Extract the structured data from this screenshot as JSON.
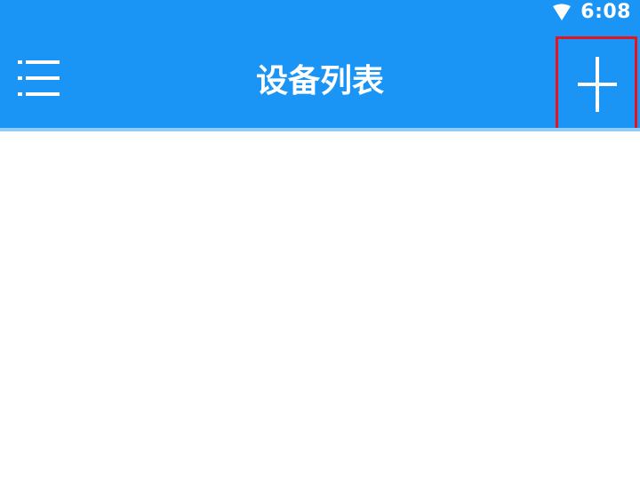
{
  "status_bar": {
    "time": "6:08",
    "signal_icon": "wifi-signal-icon"
  },
  "header": {
    "title": "设备列表",
    "menu_icon": "menu-icon",
    "add_icon": "plus-icon",
    "background_color": "#1a94f5",
    "highlight_color": "#e8141c"
  },
  "device_list": {
    "items": []
  }
}
